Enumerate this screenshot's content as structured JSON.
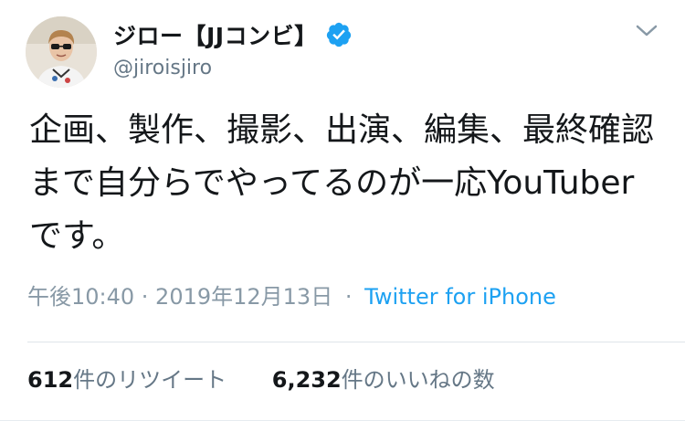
{
  "tweet": {
    "author": {
      "display_name": "ジロー【JJコンビ】",
      "handle": "@jiroisjiro",
      "verified": true
    },
    "text": "企画、製作、撮影、出演、編集、最終確認まで自分らでやってるのが一応YouTuberです。",
    "timestamp": "午後10:40 · 2019年12月13日",
    "separator": "·",
    "source": "Twitter for iPhone",
    "stats": {
      "retweets_count": "612",
      "retweets_label": "件のリツイート",
      "likes_count": "6,232",
      "likes_label": "件のいいねの数"
    }
  },
  "icons": {
    "verified": "verified-badge-icon",
    "menu": "chevron-down-icon"
  },
  "colors": {
    "link": "#1da1f2",
    "text": "#14171a",
    "secondary": "#657786",
    "meta": "#8899a6",
    "verified": "#1da1f2"
  }
}
